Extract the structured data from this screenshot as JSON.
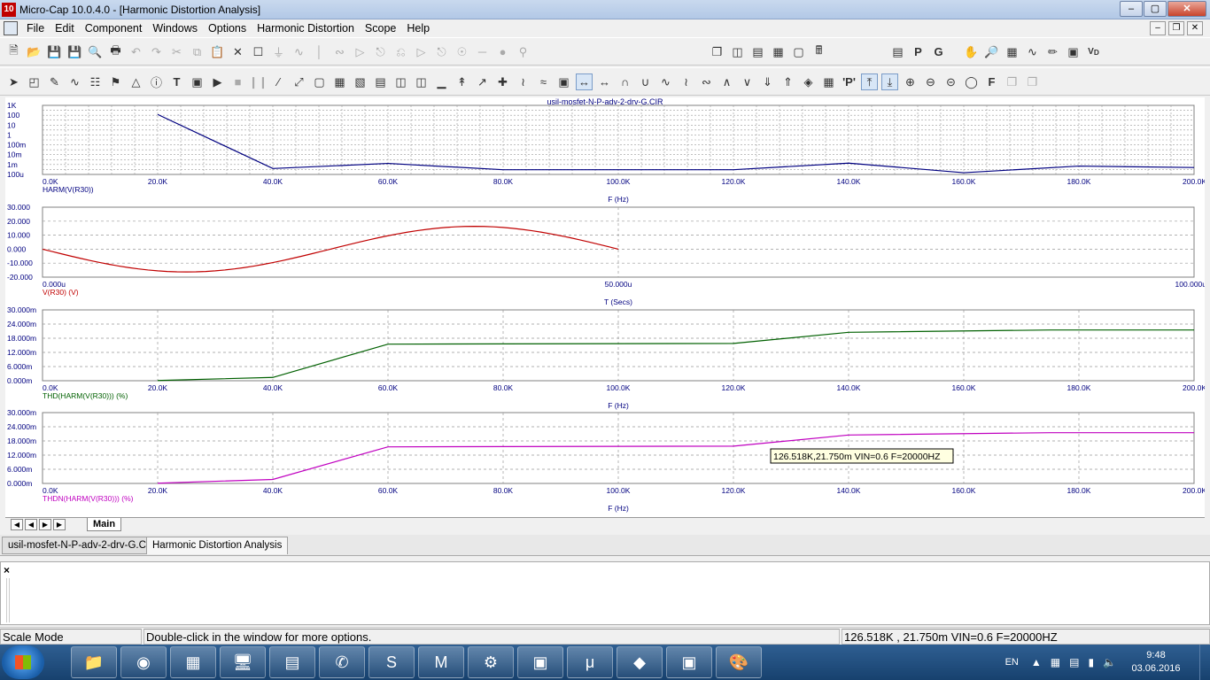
{
  "window": {
    "title": "Micro-Cap 10.0.4.0 - [Harmonic Distortion Analysis]",
    "app_icon": "10",
    "controls": [
      "minimize-icon",
      "maximize-icon",
      "close-icon"
    ]
  },
  "menu": [
    "File",
    "Edit",
    "Component",
    "Windows",
    "Options",
    "Harmonic Distortion",
    "Scope",
    "Help"
  ],
  "plot": {
    "file_title": "usil-mosfet-N-P-adv-2-drv-G.CIR",
    "panels": [
      {
        "id": "harm",
        "y_ticks": [
          "1K",
          "100",
          "10",
          "1",
          "100m",
          "10m",
          "1m",
          "100u"
        ],
        "x_ticks": [
          "0.0K",
          "20.0K",
          "40.0K",
          "60.0K",
          "80.0K",
          "100.0K",
          "120.0K",
          "140.0K",
          "160.0K",
          "180.0K",
          "200.0K"
        ],
        "trace_label": "HARM(V(R30))",
        "x_axis_label": "F (Hz)",
        "color": "#000080"
      },
      {
        "id": "vr30",
        "y_ticks": [
          "30.000",
          "20.000",
          "10.000",
          "0.000",
          "-10.000",
          "-20.000"
        ],
        "x_ticks": [
          "0.000u",
          "50.000u",
          "100.000u"
        ],
        "trace_label": "V(R30) (V)",
        "x_axis_label": "T (Secs)",
        "color": "#c00000"
      },
      {
        "id": "thd",
        "y_ticks": [
          "30.000m",
          "24.000m",
          "18.000m",
          "12.000m",
          "6.000m",
          "0.000m"
        ],
        "x_ticks": [
          "0.0K",
          "20.0K",
          "40.0K",
          "60.0K",
          "80.0K",
          "100.0K",
          "120.0K",
          "140.0K",
          "160.0K",
          "180.0K",
          "200.0K"
        ],
        "trace_label": "THD(HARM(V(R30))) (%)",
        "x_axis_label": "F (Hz)",
        "color": "#006000"
      },
      {
        "id": "thdn",
        "y_ticks": [
          "30.000m",
          "24.000m",
          "18.000m",
          "12.000m",
          "6.000m",
          "0.000m"
        ],
        "x_ticks": [
          "0.0K",
          "20.0K",
          "40.0K",
          "60.0K",
          "80.0K",
          "100.0K",
          "120.0K",
          "140.0K",
          "160.0K",
          "180.0K",
          "200.0K"
        ],
        "trace_label": "THDN(HARM(V(R30))) (%)",
        "x_axis_label": "F (Hz)",
        "color": "#c000c0"
      }
    ],
    "tooltip": "126.518K,21.750m VIN=0.6 F=20000HZ"
  },
  "chart_data": [
    {
      "type": "line",
      "title": "usil-mosfet-N-P-adv-2-drv-G.CIR",
      "xlabel": "F (Hz)",
      "ylabel": "",
      "scale": "log-y",
      "xlim": [
        0,
        200000
      ],
      "series": [
        {
          "name": "HARM(V(R30))",
          "x": [
            20000,
            40000,
            60000,
            80000,
            100000,
            120000,
            140000,
            160000,
            180000,
            200000
          ],
          "y": [
            120,
            0.0004,
            0.0013,
            0.0003,
            0.0003,
            0.0003,
            0.0014,
            0.00015,
            0.0007,
            0.0005
          ]
        }
      ]
    },
    {
      "type": "line",
      "xlabel": "T (Secs)",
      "ylabel": "",
      "xlim": [
        0,
        0.0001
      ],
      "ylim": [
        -20,
        30
      ],
      "series": [
        {
          "name": "V(R30) (V)",
          "x": [
            0,
            6.25e-06,
            1.25e-05,
            1.875e-05,
            2.5e-05,
            3.125e-05,
            3.75e-05,
            4.375e-05,
            5e-05
          ],
          "y": [
            0,
            -11.5,
            -16.3,
            -11.5,
            0,
            11.5,
            16.3,
            11.5,
            0
          ]
        }
      ]
    },
    {
      "type": "line",
      "xlabel": "F (Hz)",
      "ylabel": "",
      "xlim": [
        0,
        200000
      ],
      "ylim": [
        0,
        0.03
      ],
      "series": [
        {
          "name": "THD(HARM(V(R30))) (%)",
          "x": [
            20000,
            40000,
            60000,
            120000,
            140000,
            175000,
            200000
          ],
          "y": [
            0.0001,
            0.0014,
            0.0155,
            0.0158,
            0.0205,
            0.0215,
            0.0215
          ]
        }
      ]
    },
    {
      "type": "line",
      "xlabel": "F (Hz)",
      "ylabel": "",
      "xlim": [
        0,
        200000
      ],
      "ylim": [
        0,
        0.03
      ],
      "series": [
        {
          "name": "THDN(HARM(V(R30))) (%)",
          "x": [
            20000,
            40000,
            60000,
            120000,
            140000,
            175000,
            200000
          ],
          "y": [
            0.0001,
            0.0017,
            0.0155,
            0.0158,
            0.0205,
            0.0215,
            0.0215
          ]
        }
      ]
    }
  ],
  "sheet_tabs": {
    "nav_buttons": [
      "first-icon",
      "prev-icon",
      "next-icon",
      "last-icon"
    ],
    "active": "Main"
  },
  "doc_tabs": [
    "usil-mosfet-N-P-adv-2-drv-G.CIR",
    "Harmonic Distortion Analysis"
  ],
  "output_close": "×",
  "status": {
    "mode": "Scale Mode",
    "hint": "Double-click in the window for more options.",
    "readout": "126.518K , 21.750m VIN=0.6 F=20000HZ"
  },
  "taskbar": {
    "language": "EN",
    "time": "9:48",
    "date": "03.06.2016",
    "apps": [
      "explorer-icon",
      "chrome-icon",
      "calculator-icon",
      "remote-icon",
      "calc-icon",
      "viber-icon",
      "skype-icon",
      "mfc-icon",
      "tool-icon",
      "window-icon",
      "utorrent-icon",
      "microcap-icon",
      "window2-icon",
      "paint-icon"
    ]
  }
}
